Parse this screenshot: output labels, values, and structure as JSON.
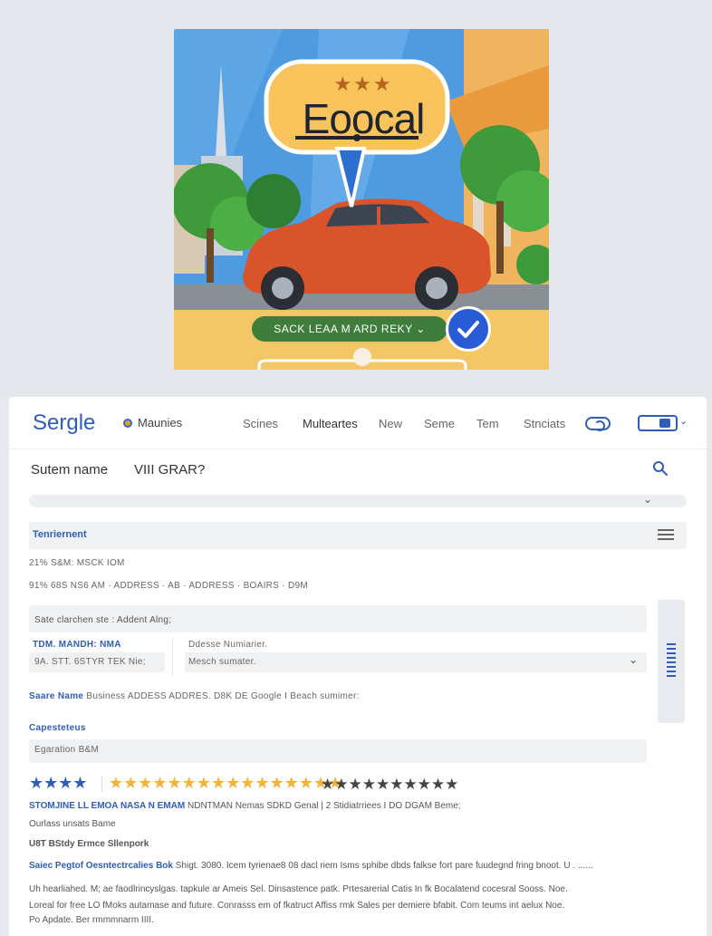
{
  "hero": {
    "stars": "★★★",
    "title": "Eoocal",
    "cta_label": "SACK LEAA M ARD REKY ⌄"
  },
  "topbar": {
    "logo": "Sergle",
    "chip_label": "Maunies",
    "nav": [
      "Scines",
      "Multeartes",
      "New",
      "Seme",
      "Tem",
      "Stnciats"
    ]
  },
  "search": {
    "label": "Sutem name",
    "value": "VIII GRAR?"
  },
  "section": {
    "title": "Tenriernent"
  },
  "lines": {
    "line1": "21% S&M: MSCK IOM",
    "line2": "91% 68S NS6 AM  ·  ADDRESS  ·  AB  ·  ADDRESS  ·  BOAIRS  ·  D9M",
    "input1": "Sate clarchen ste : Addent Alng;",
    "left_label_1": "TDM. MANDH: NMA",
    "left_label_2": "9A. STT. 6STYR TEK Nie;",
    "right_label": "Ddesse Numiarier.",
    "right_select": "Mesch sumater.",
    "biz_strong": "Saare Name",
    "biz_rest": "Business ADDESS ADDRES. D8K DE Google I Beach sumimer:",
    "cap_title": "Capesteteus",
    "cap_input": "Egaration B&M",
    "listing_title": "STOMJINE LL EMOA NASA N EMAM",
    "listing_rest": "NDNTMAN Nemas SDKD Genal | 2 Stidiatrriees I  DO DGAM Beme;",
    "listing_sub": "Ourlass unsats Bame",
    "link1": "U8T BStdy Ermce Sllenpork",
    "para1_strong": "Saiec Pegtof Oesntectrcalies Bok",
    "para1_rest": "Shigt. 3080. Icem tyrienae8 08 dacl riem Isms sphibe dbds falkse fort pare fuudegnd fring bnoot. U . ......",
    "para2": "Uh hearliahed. M; ae faodlrincyslgas. tapkule ar Ameis Sel. Dinsastence patk. Prtesarerial Catis In fk Bocalatend cocesral Sooss. Noe.",
    "para3": "Loreal for free LO fMoks autamase and future. Conrasss em of  fkatruct Affiss rmk Sales per demiere bfabit. Com teums int aelux Noe.",
    "para4": "Po Apdate. Ber rmmmnarm IIII."
  },
  "ratings": {
    "blue": "★★★★",
    "gold": "★★★★★★★★★★★★★★★★",
    "dark": "★★★★★★★★★★"
  },
  "colors": {
    "accent_blue": "#2f5db8",
    "gold": "#f2b33d",
    "cta_green": "#3f7d3c"
  }
}
